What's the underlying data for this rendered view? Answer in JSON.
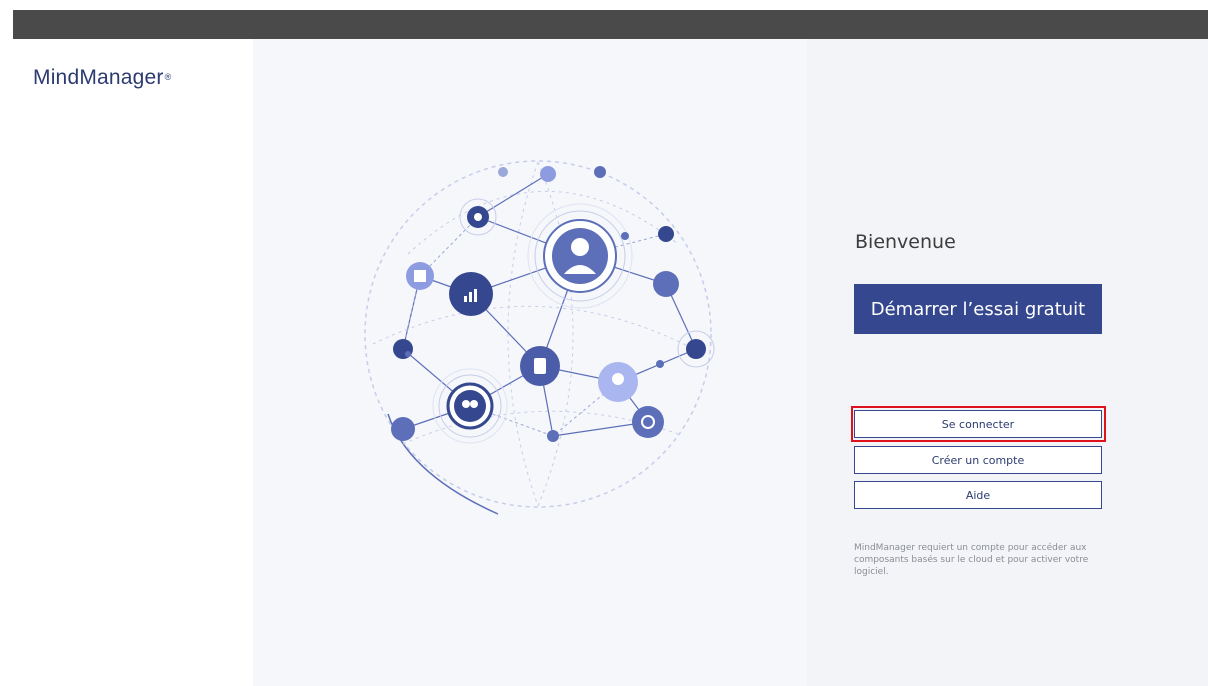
{
  "app": {
    "logo_text": "MindManager",
    "logo_mark": "®"
  },
  "welcome": {
    "heading": "Bienvenue"
  },
  "buttons": {
    "trial": "Démarrer l’essai gratuit",
    "connect": "Se connecter",
    "create": "Créer un compte",
    "help": "Aide"
  },
  "note": "MindManager requiert un compte pour accéder aux composants basés sur le cloud et pour activer votre logiciel.",
  "colors": {
    "brand": "#35488f",
    "highlight": "#e0111b",
    "titlebar": "#4a4a4a"
  },
  "illustration": {
    "name": "globe-network-illustration",
    "icons": [
      "user-icon",
      "chart-icon",
      "chess-icon",
      "lightbulb-icon",
      "team-icon",
      "target-icon",
      "calendar-icon",
      "mobile-icon"
    ]
  }
}
